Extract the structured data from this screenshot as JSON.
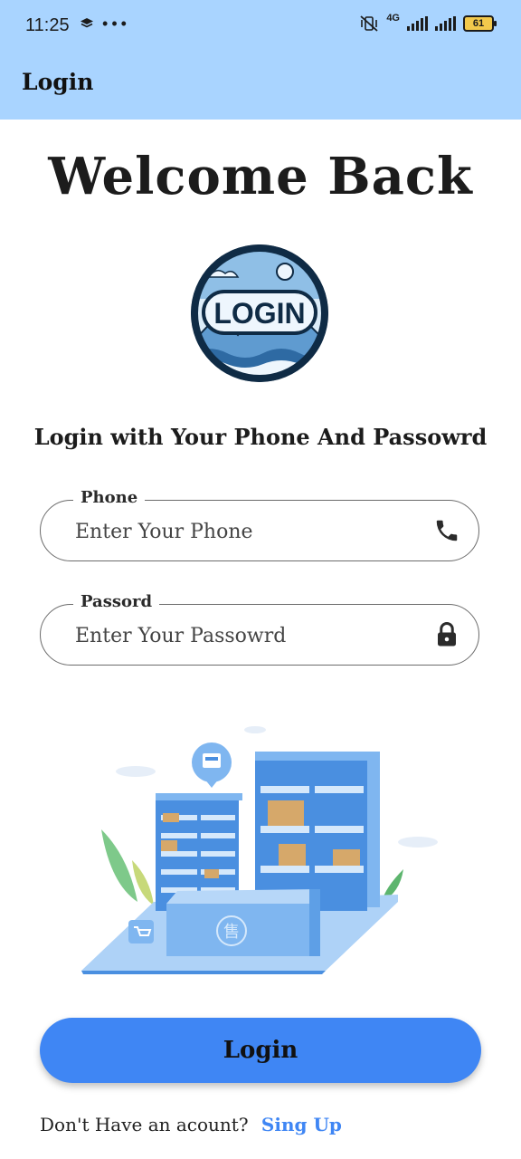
{
  "status_bar": {
    "time": "11:25",
    "network": "4G",
    "battery": "61"
  },
  "app_bar": {
    "title": "Login"
  },
  "welcome_title": "Welcome Back",
  "logo": {
    "text": "LOGIN"
  },
  "subtitle": "Login with Your Phone And Passowrd",
  "phone_field": {
    "label": "Phone",
    "placeholder": "Enter Your Phone",
    "icon": "phone-icon"
  },
  "password_field": {
    "label": "Passord",
    "placeholder": "Enter Your Passowrd",
    "icon": "lock-icon"
  },
  "illustration": {
    "sign_char": "售"
  },
  "login_button": {
    "label": "Login"
  },
  "signup": {
    "prompt": "Don't Have an acount?",
    "link": "Sing Up"
  },
  "colors": {
    "header_bg": "#a9d4ff",
    "accent": "#3f86f4"
  }
}
